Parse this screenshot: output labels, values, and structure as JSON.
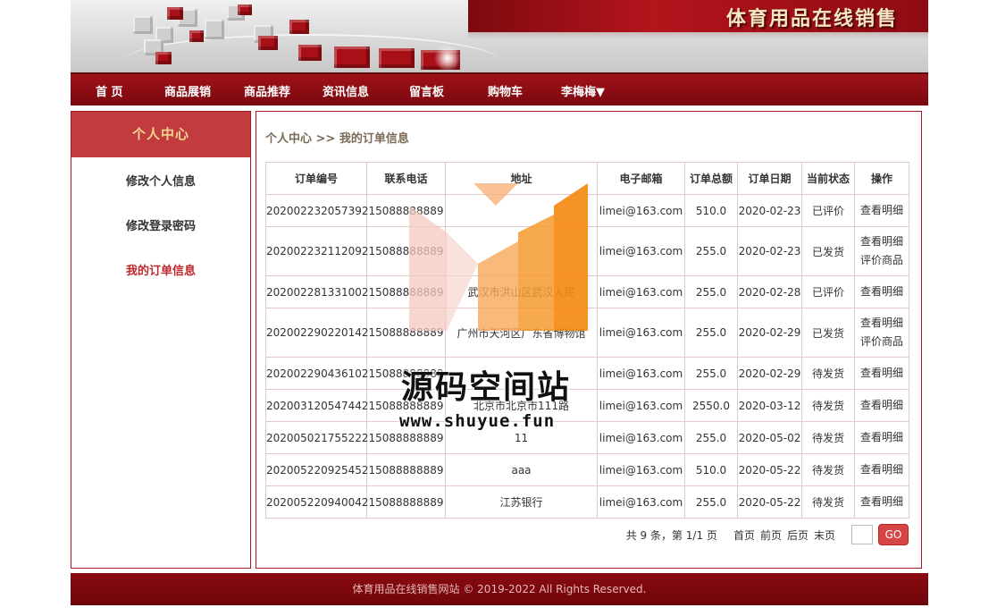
{
  "site": {
    "title": "体育用品在线销售"
  },
  "nav": {
    "items": [
      "首 页",
      "商品展销",
      "商品推荐",
      "资讯信息",
      "留言板",
      "购物车",
      "李梅梅▼"
    ]
  },
  "sidebar": {
    "heading": "个人中心",
    "links": [
      "修改个人信息",
      "修改登录密码",
      "我的订单信息"
    ]
  },
  "breadcrumb": "个人中心 >> 我的订单信息",
  "table": {
    "headers": [
      "订单编号",
      "联系电话",
      "地址",
      "电子邮箱",
      "订单总额",
      "订单日期",
      "当前状态",
      "操作"
    ],
    "rows": [
      {
        "id": "202002232057392",
        "phone": "15088888889",
        "address": "",
        "email": "limei@163.com",
        "total": "510.0",
        "date": "2020-02-23",
        "status": "已评价",
        "actions": [
          "查看明细"
        ]
      },
      {
        "id": "202002232112092",
        "phone": "15088888889",
        "address": "",
        "email": "limei@163.com",
        "total": "255.0",
        "date": "2020-02-23",
        "status": "已发货",
        "actions": [
          "查看明细",
          "评价商品"
        ]
      },
      {
        "id": "202002281331002",
        "phone": "15088888889",
        "address": "武汉市洪山区武汉人民",
        "email": "limei@163.com",
        "total": "255.0",
        "date": "2020-02-28",
        "status": "已评价",
        "actions": [
          "查看明细"
        ]
      },
      {
        "id": "202002290220142",
        "phone": "15088888889",
        "address": "广州市天河区广东省博物馆",
        "email": "limei@163.com",
        "total": "255.0",
        "date": "2020-02-29",
        "status": "已发货",
        "actions": [
          "查看明细",
          "评价商品"
        ]
      },
      {
        "id": "202002290436102",
        "phone": "15088888889",
        "address": "",
        "email": "limei@163.com",
        "total": "255.0",
        "date": "2020-02-29",
        "status": "待发货",
        "actions": [
          "查看明细"
        ]
      },
      {
        "id": "202003120547442",
        "phone": "15088888889",
        "address": "北京市北京市111路",
        "email": "limei@163.com",
        "total": "2550.0",
        "date": "2020-03-12",
        "status": "待发货",
        "actions": [
          "查看明细"
        ]
      },
      {
        "id": "202005021755222",
        "phone": "15088888889",
        "address": "11",
        "email": "limei@163.com",
        "total": "255.0",
        "date": "2020-05-02",
        "status": "待发货",
        "actions": [
          "查看明细"
        ]
      },
      {
        "id": "202005220925452",
        "phone": "15088888889",
        "address": "aaa",
        "email": "limei@163.com",
        "total": "510.0",
        "date": "2020-05-22",
        "status": "待发货",
        "actions": [
          "查看明细"
        ]
      },
      {
        "id": "202005220940042",
        "phone": "15088888889",
        "address": "江苏银行",
        "email": "limei@163.com",
        "total": "255.0",
        "date": "2020-05-22",
        "status": "待发货",
        "actions": [
          "查看明细"
        ]
      }
    ]
  },
  "pager": {
    "info": "共 9 条，第 1/1 页",
    "first": "首页",
    "prev": "前页",
    "next": "后页",
    "last": "末页",
    "page_input_value": "",
    "go": "GO"
  },
  "footer": "体育用品在线销售网站  © 2019-2022 All Rights Reserved.",
  "watermark": {
    "title": "源码空间站",
    "url": "www.shuyue.fun"
  },
  "colors": {
    "brand_red": "#a0121a",
    "accent_gold": "#f3d590",
    "active_link": "#c0282c",
    "watermark_orange": "#f5870d"
  }
}
